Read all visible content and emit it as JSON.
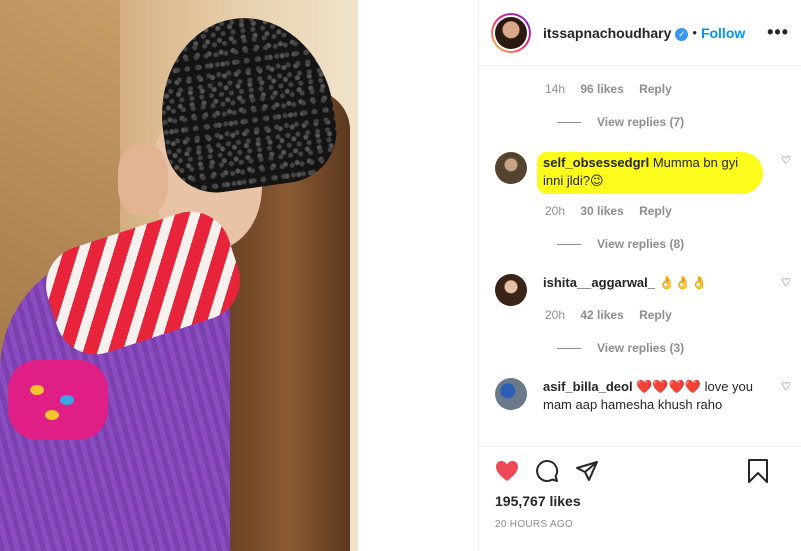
{
  "header": {
    "username": "itssapnachoudhary",
    "verified_icon": "verified-badge-icon",
    "follow_label": "Follow",
    "more_label": "•••"
  },
  "reply_block_1": {
    "time": "14h",
    "likes": "96 likes",
    "reply": "Reply",
    "view_replies": "View replies (7)"
  },
  "comments": [
    {
      "username": "self_obsessedgrl",
      "text": "Mumma bn gyi inni jldi?",
      "emoji": "😉",
      "time": "20h",
      "likes": "30 likes",
      "reply": "Reply",
      "view_replies": "View replies (8)",
      "highlight_color": "#fbfb1c"
    },
    {
      "username": "ishita__aggarwal_",
      "text": "👌👌👌",
      "time": "20h",
      "likes": "42 likes",
      "reply": "Reply",
      "view_replies": "View replies (3)"
    },
    {
      "username": "asif_billa_deol",
      "text": "❤️❤️❤️❤️ love you mam aap hamesha khush raho"
    }
  ],
  "footer": {
    "likes": "195,767 likes",
    "posted": "20 HOURS AGO"
  },
  "colors": {
    "accent": "#0095f6",
    "like_red": "#ed4956",
    "muted": "#8e8e8e"
  }
}
